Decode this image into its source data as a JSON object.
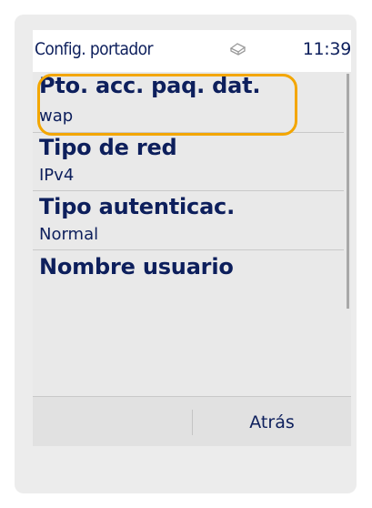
{
  "status": {
    "title": "Config. portador",
    "time": "11:39",
    "icon": "data-transfer-icon"
  },
  "list": {
    "items": [
      {
        "title": "Pto. acc. paq. dat.",
        "value": "wap",
        "selected": true
      },
      {
        "title": "Tipo de red",
        "value": "IPv4",
        "selected": false
      },
      {
        "title": "Tipo autenticac.",
        "value": "Normal",
        "selected": false
      },
      {
        "title": "Nombre usuario",
        "value": "",
        "selected": false
      }
    ]
  },
  "softkeys": {
    "left": "",
    "right": "Atrás"
  },
  "colors": {
    "text": "#0d1f5c",
    "highlight": "#f3a600",
    "list_background": "#e9e9e9"
  }
}
